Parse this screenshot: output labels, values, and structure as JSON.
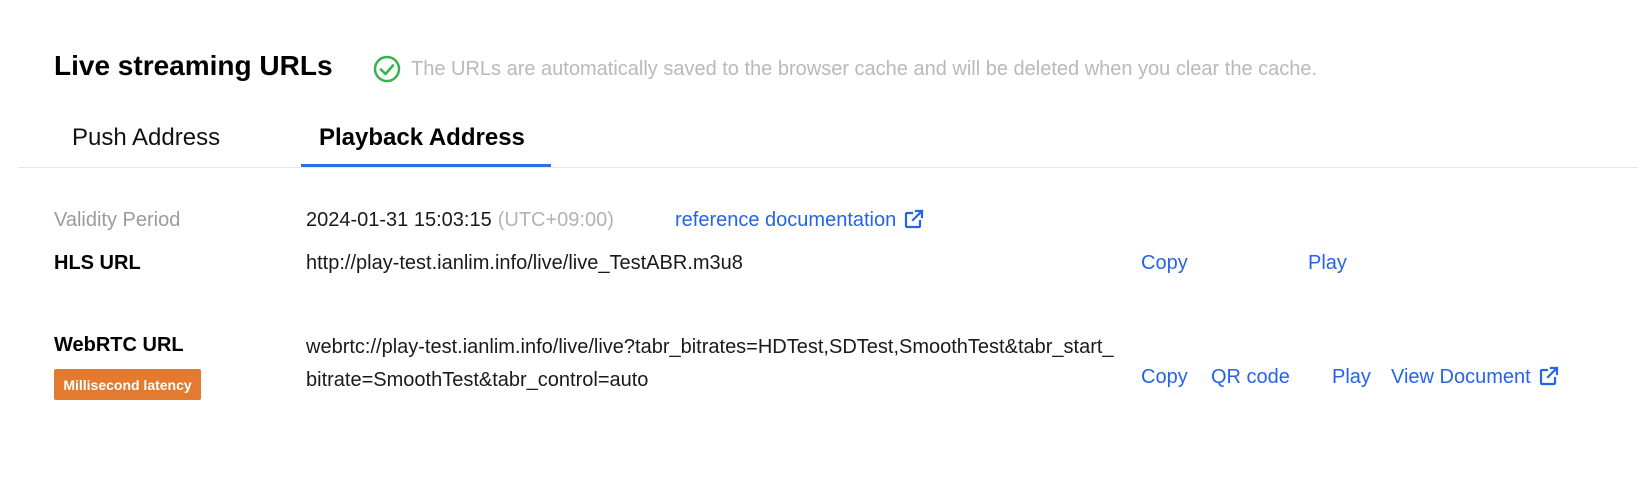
{
  "header": {
    "title": "Live streaming URLs",
    "notice": "The URLs are automatically saved to the browser cache and will be deleted when you clear the cache.",
    "notice_icon": "check-circle-icon",
    "success_color": "#34b54a"
  },
  "tabs": [
    {
      "label": "Push Address",
      "active": false
    },
    {
      "label": "Playback Address",
      "active": true
    }
  ],
  "validity": {
    "label": "Validity Period",
    "value": "2024-01-31 15:03:15",
    "timezone": "(UTC+09:00)",
    "doc_link": "reference documentation"
  },
  "hls": {
    "label": "HLS URL",
    "url": "http://play-test.ianlim.info/live/live_TestABR.m3u8",
    "copy": "Copy",
    "play": "Play"
  },
  "webrtc": {
    "label": "WebRTC URL",
    "badge": "Millisecond latency",
    "url": "webrtc://play-test.ianlim.info/live/live?tabr_bitrates=HDTest,SDTest,SmoothTest&tabr_start_bitrate=SmoothTest&tabr_control=auto",
    "copy": "Copy",
    "qr": "QR code",
    "play": "Play",
    "view_doc": "View Document"
  },
  "colors": {
    "link": "#2563eb",
    "badge": "#e27b2f",
    "tab_underline": "#2f6fe4"
  }
}
